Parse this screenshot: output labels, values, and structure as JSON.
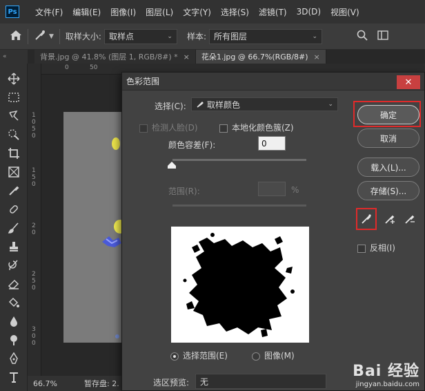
{
  "app": {
    "logo": "Ps"
  },
  "menu": [
    "文件(F)",
    "编辑(E)",
    "图像(I)",
    "图层(L)",
    "文字(Y)",
    "选择(S)",
    "滤镜(T)",
    "3D(D)",
    "视图(V)"
  ],
  "options": {
    "sample_size_label": "取样大小:",
    "sample_size_value": "取样点",
    "sample_label": "样本:",
    "sample_value": "所有图层"
  },
  "tabs": [
    {
      "label": "背景.jpg @ 41.8% (图层 1, RGB/8#) *",
      "close": "×"
    },
    {
      "label": "花朵1.jpg @ 66.7%(RGB/8#)",
      "close": "×"
    }
  ],
  "tab_collapse": "«",
  "ruler": {
    "top": [
      "0",
      "50"
    ],
    "left": [
      "1",
      "0",
      "5",
      "0",
      "1",
      "5",
      "0",
      "2",
      "0",
      "2",
      "5",
      "0",
      "3",
      "0",
      "0"
    ]
  },
  "status": {
    "zoom": "66.7%",
    "scratch": "暂存盘: 2."
  },
  "dialog": {
    "title": "色彩范围",
    "close": "✕",
    "select_label": "选择(C):",
    "select_value": "取样颜色",
    "detect_faces": "检测人脸(D)",
    "localized": "本地化颜色簇(Z)",
    "fuzziness_label": "颜色容差(F):",
    "fuzziness_value": "0",
    "range_label": "范围(R):",
    "range_unit": "%",
    "radio_selection": "选择范围(E)",
    "radio_image": "图像(M)",
    "preview_label": "选区预览:",
    "preview_value": "无",
    "invert": "反相(I)",
    "buttons": {
      "ok": "确定",
      "cancel": "取消",
      "load": "载入(L)...",
      "save": "存储(S)..."
    }
  },
  "watermark": {
    "logo": "Bai 经验",
    "url": "jingyan.baidu.com"
  }
}
